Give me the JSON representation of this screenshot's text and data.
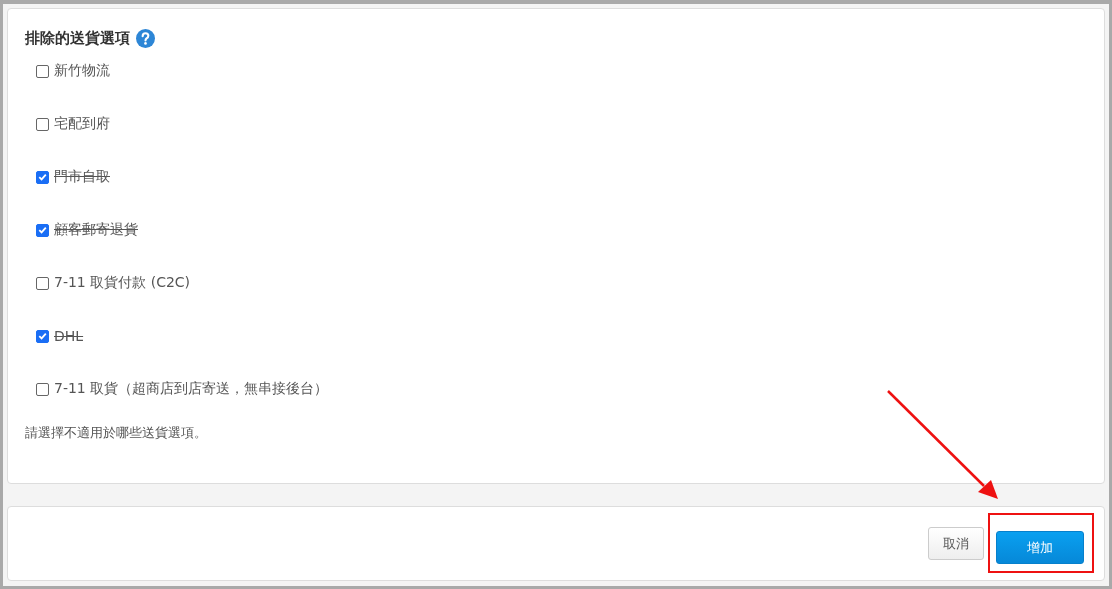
{
  "section": {
    "title": "排除的送貨選項",
    "help_icon": true
  },
  "options": [
    {
      "label": "新竹物流",
      "checked": false
    },
    {
      "label": "宅配到府",
      "checked": false
    },
    {
      "label": "門市自取",
      "checked": true
    },
    {
      "label": "顧客郵寄退貨",
      "checked": true
    },
    {
      "label": "7-11 取貨付款 (C2C)",
      "checked": false
    },
    {
      "label": "DHL",
      "checked": true
    },
    {
      "label": "7-11 取貨（超商店到店寄送，無串接後台）",
      "checked": false
    }
  ],
  "hint": "請選擇不適用於哪些送貨選項。",
  "buttons": [
    {
      "label": "取消",
      "kind": "secondary"
    },
    {
      "label": "增加",
      "kind": "primary",
      "highlighted": true
    }
  ]
}
